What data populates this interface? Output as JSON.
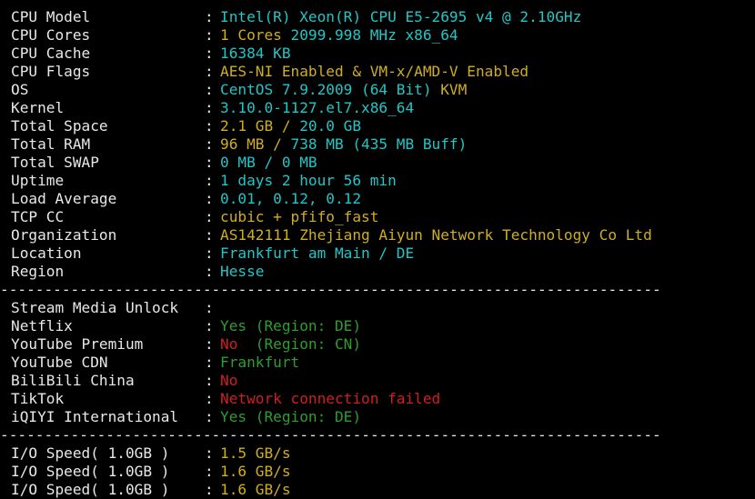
{
  "colors": {
    "cyan": "#22c6c6",
    "yellow": "#cfae1f",
    "green": "#2f9d2f",
    "red": "#d11f1f",
    "white": "#e8e8e8",
    "background": "#000000"
  },
  "separator": "---------------------------------------------------------------------------",
  "system_info": [
    {
      "label": "CPU Model",
      "parts": [
        {
          "text": "Intel(R) Xeon(R) CPU E5-2695 v4 @ 2.10GHz",
          "color": "cyan"
        }
      ]
    },
    {
      "label": "CPU Cores",
      "parts": [
        {
          "text": "1 Cores ",
          "color": "yellow"
        },
        {
          "text": "2099.998 MHz x86_64",
          "color": "cyan"
        }
      ]
    },
    {
      "label": "CPU Cache",
      "parts": [
        {
          "text": "16384 KB",
          "color": "cyan"
        }
      ]
    },
    {
      "label": "CPU Flags",
      "parts": [
        {
          "text": "AES-NI Enabled & VM-x/AMD-V Enabled",
          "color": "yellow"
        }
      ]
    },
    {
      "label": "OS",
      "parts": [
        {
          "text": "CentOS 7.9.2009 (64 Bit) ",
          "color": "cyan"
        },
        {
          "text": "KVM",
          "color": "yellow"
        }
      ]
    },
    {
      "label": "Kernel",
      "parts": [
        {
          "text": "3.10.0-1127.el7.x86_64",
          "color": "cyan"
        }
      ]
    },
    {
      "label": "Total Space",
      "parts": [
        {
          "text": "2.1 GB / ",
          "color": "yellow"
        },
        {
          "text": "20.0 GB",
          "color": "cyan"
        }
      ]
    },
    {
      "label": "Total RAM",
      "parts": [
        {
          "text": "96 MB / ",
          "color": "yellow"
        },
        {
          "text": "738 MB ",
          "color": "cyan"
        },
        {
          "text": "(435 MB Buff)",
          "color": "cyan"
        }
      ]
    },
    {
      "label": "Total SWAP",
      "parts": [
        {
          "text": "0 MB / ",
          "color": "cyan"
        },
        {
          "text": "0 MB",
          "color": "cyan"
        }
      ]
    },
    {
      "label": "Uptime",
      "parts": [
        {
          "text": "1 days 2 hour 56 min",
          "color": "cyan"
        }
      ]
    },
    {
      "label": "Load Average",
      "parts": [
        {
          "text": "0.01, 0.12, 0.12",
          "color": "cyan"
        }
      ]
    },
    {
      "label": "TCP CC",
      "parts": [
        {
          "text": "cubic + pfifo_fast",
          "color": "yellow"
        }
      ]
    },
    {
      "label": "Organization",
      "parts": [
        {
          "text": "AS142111 Zhejiang Aiyun Network Technology Co Ltd",
          "color": "yellow"
        }
      ]
    },
    {
      "label": "Location",
      "parts": [
        {
          "text": "Frankfurt am Main / DE",
          "color": "cyan"
        }
      ]
    },
    {
      "label": "Region",
      "parts": [
        {
          "text": "Hesse",
          "color": "cyan"
        }
      ]
    }
  ],
  "media_unlock": {
    "header": "Stream Media Unlock",
    "items": [
      {
        "label": "Netflix",
        "parts": [
          {
            "text": "Yes (Region: DE)",
            "color": "green"
          }
        ]
      },
      {
        "label": "YouTube Premium",
        "parts": [
          {
            "text": "No ",
            "color": "red"
          },
          {
            "text": " (Region: CN)",
            "color": "green"
          }
        ]
      },
      {
        "label": "YouTube CDN",
        "parts": [
          {
            "text": "Frankfurt",
            "color": "green"
          }
        ]
      },
      {
        "label": "BiliBili China",
        "parts": [
          {
            "text": "No",
            "color": "red"
          }
        ]
      },
      {
        "label": "TikTok",
        "parts": [
          {
            "text": "Network connection failed",
            "color": "red"
          }
        ]
      },
      {
        "label": "iQIYI International",
        "parts": [
          {
            "text": "Yes (Region: DE)",
            "color": "green"
          }
        ]
      }
    ]
  },
  "io_speed": [
    {
      "label": "I/O Speed( 1.0GB )",
      "parts": [
        {
          "text": "1.5 GB/s",
          "color": "yellow"
        }
      ]
    },
    {
      "label": "I/O Speed( 1.0GB )",
      "parts": [
        {
          "text": "1.6 GB/s",
          "color": "yellow"
        }
      ]
    },
    {
      "label": "I/O Speed( 1.0GB )",
      "parts": [
        {
          "text": "1.6 GB/s",
          "color": "yellow"
        }
      ]
    }
  ],
  "colon": ":"
}
